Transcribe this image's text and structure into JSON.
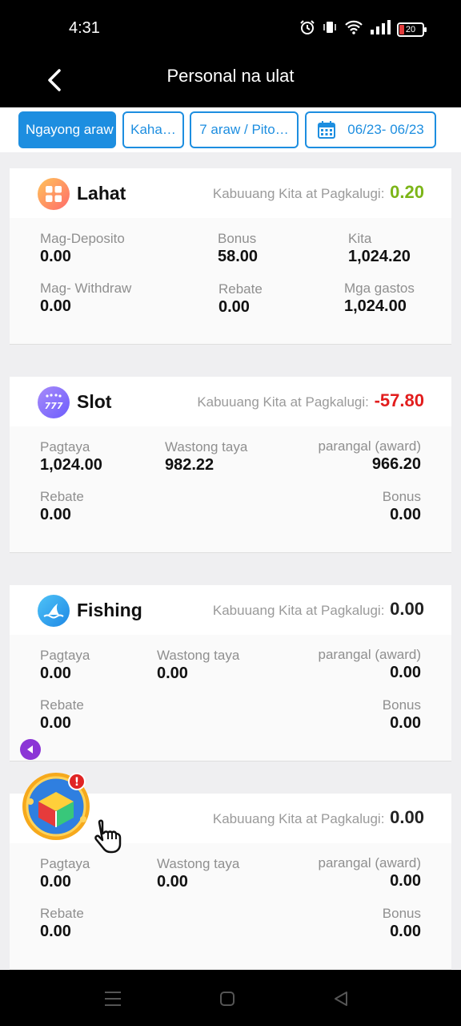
{
  "status_bar": {
    "time": "4:31",
    "battery_level": "20",
    "icons": [
      "alarm-icon",
      "vibrate-icon",
      "wifi-icon",
      "signal-icon",
      "battery-icon"
    ]
  },
  "header": {
    "back_icon": "chevron-left-icon",
    "title": "Personal na ulat"
  },
  "filters": {
    "today": "Ngayong araw",
    "yesterday": "Kaha…",
    "seven_days": "7 araw / Pito…",
    "date_range": "06/23- 06/23",
    "calendar_icon": "calendar-icon"
  },
  "colors": {
    "accent": "#1d8ee0",
    "profit": "#7cb518",
    "loss": "#e21d1d",
    "header_bg": "#000000"
  },
  "cards": [
    {
      "name": "Lahat",
      "icon": "grid-icon",
      "pl_label": "Kabuuang Kita at Pagkalugi:",
      "pl_value": "0.20",
      "stats": [
        {
          "label": "Mag-Deposito",
          "value": "0.00"
        },
        {
          "label": "Bonus",
          "value": "58.00"
        },
        {
          "label": "Kita",
          "value": "1,024.20"
        },
        {
          "label": "Mag- Withdraw",
          "value": "0.00"
        },
        {
          "label": "Rebate",
          "value": "0.00"
        },
        {
          "label": "Mga gastos",
          "value": "1,024.00"
        }
      ]
    },
    {
      "name": "Slot",
      "icon": "slot-777-icon",
      "pl_label": "Kabuuang Kita at Pagkalugi:",
      "pl_value": "-57.80",
      "stats": [
        {
          "label": "Pagtaya",
          "value": "1,024.00"
        },
        {
          "label": "Wastong taya",
          "value": "982.22"
        },
        {
          "label": "parangal (award)",
          "value": "966.20"
        },
        {
          "label": "Rebate",
          "value": "0.00"
        },
        {
          "label": "Bonus",
          "value": "0.00"
        }
      ]
    },
    {
      "name": "Fishing",
      "icon": "shark-fin-icon",
      "pl_label": "Kabuuang Kita at Pagkalugi:",
      "pl_value": "0.00",
      "stats": [
        {
          "label": "Pagtaya",
          "value": "0.00"
        },
        {
          "label": "Wastong taya",
          "value": "0.00"
        },
        {
          "label": "parangal (award)",
          "value": "0.00"
        },
        {
          "label": "Rebate",
          "value": "0.00"
        },
        {
          "label": "Bonus",
          "value": "0.00"
        }
      ]
    },
    {
      "pl_label": "Kabuuang Kita at Pagkalugi:",
      "pl_value": "0.00",
      "stats": [
        {
          "label": "Pagtaya",
          "value": "0.00"
        },
        {
          "label": "Wastong taya",
          "value": "0.00"
        },
        {
          "label": "parangal (award)",
          "value": "0.00"
        },
        {
          "label": "Rebate",
          "value": "0.00"
        },
        {
          "label": "Bonus",
          "value": "0.00"
        }
      ]
    }
  ],
  "floating": {
    "collapse_icon": "triangle-left-icon",
    "treasure_icon": "treasure-box-icon",
    "alert_badge": "!",
    "hand_icon": "pointing-hand-icon"
  },
  "nav_bar": {
    "icons": [
      "menu-icon",
      "home-square-icon",
      "back-triangle-icon"
    ]
  }
}
